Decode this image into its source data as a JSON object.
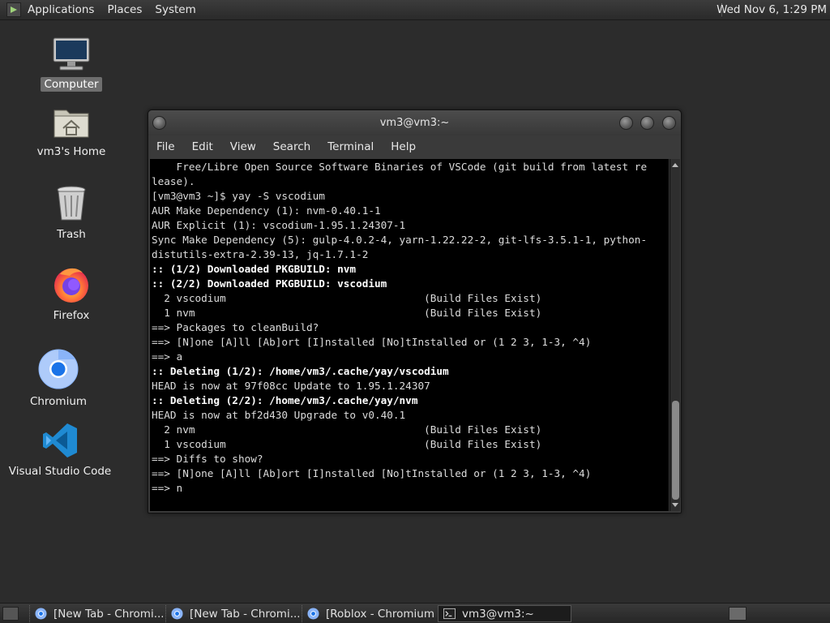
{
  "top_panel": {
    "menus": [
      "Applications",
      "Places",
      "System"
    ],
    "clock": "Wed Nov  6,  1:29 PM"
  },
  "desktop": {
    "icons": [
      {
        "label": "Computer",
        "icon": "computer-icon"
      },
      {
        "label": "vm3's Home",
        "icon": "home-folder-icon"
      },
      {
        "label": "Trash",
        "icon": "trash-icon"
      },
      {
        "label": "Firefox",
        "icon": "firefox-icon"
      },
      {
        "label": "Chromium",
        "icon": "chromium-icon"
      },
      {
        "label": "Visual Studio Code",
        "icon": "vscode-icon"
      }
    ]
  },
  "terminal": {
    "title": "vm3@vm3:~",
    "menus": [
      "File",
      "Edit",
      "View",
      "Search",
      "Terminal",
      "Help"
    ],
    "lines": [
      {
        "t": "    Free/Libre Open Source Software Binaries of VSCode (git build from latest re",
        "b": false
      },
      {
        "t": "lease).",
        "b": false
      },
      {
        "t": "[vm3@vm3 ~]$ yay -S vscodium",
        "b": false
      },
      {
        "t": "AUR Make Dependency (1): nvm-0.40.1-1",
        "b": false
      },
      {
        "t": "AUR Explicit (1): vscodium-1.95.1.24307-1",
        "b": false
      },
      {
        "t": "Sync Make Dependency (5): gulp-4.0.2-4, yarn-1.22.22-2, git-lfs-3.5.1-1, python-",
        "b": false
      },
      {
        "t": "distutils-extra-2.39-13, jq-1.7.1-2",
        "b": false
      },
      {
        "t": ":: (1/2) Downloaded PKGBUILD: nvm",
        "b": true
      },
      {
        "t": ":: (2/2) Downloaded PKGBUILD: vscodium",
        "b": true
      },
      {
        "t": "  2 vscodium                                (Build Files Exist)",
        "b": false
      },
      {
        "t": "  1 nvm                                     (Build Files Exist)",
        "b": false
      },
      {
        "t": "==> Packages to cleanBuild?",
        "b": false
      },
      {
        "t": "==> [N]one [A]ll [Ab]ort [I]nstalled [No]tInstalled or (1 2 3, 1-3, ^4)",
        "b": false
      },
      {
        "t": "==> a",
        "b": false
      },
      {
        "t": ":: Deleting (1/2): /home/vm3/.cache/yay/vscodium",
        "b": true
      },
      {
        "t": "HEAD is now at 97f08cc Update to 1.95.1.24307",
        "b": false
      },
      {
        "t": ":: Deleting (2/2): /home/vm3/.cache/yay/nvm",
        "b": true
      },
      {
        "t": "HEAD is now at bf2d430 Upgrade to v0.40.1",
        "b": false
      },
      {
        "t": "  2 nvm                                     (Build Files Exist)",
        "b": false
      },
      {
        "t": "  1 vscodium                                (Build Files Exist)",
        "b": false
      },
      {
        "t": "==> Diffs to show?",
        "b": false
      },
      {
        "t": "==> [N]one [A]ll [Ab]ort [I]nstalled [No]tInstalled or (1 2 3, 1-3, ^4)",
        "b": false
      },
      {
        "t": "==> n",
        "b": false
      }
    ]
  },
  "taskbar": {
    "tasks": [
      {
        "label": "[New Tab - Chromi...",
        "icon": "chromium-icon",
        "active": false
      },
      {
        "label": "[New Tab - Chromi...",
        "icon": "chromium-icon",
        "active": false
      },
      {
        "label": "[Roblox - Chromium]",
        "icon": "chromium-icon",
        "active": false
      },
      {
        "label": "vm3@vm3:~",
        "icon": "terminal-icon",
        "active": true
      }
    ]
  },
  "colors": {
    "panel_bg": "#2f2f2f",
    "desktop_bg": "#2c2c2c",
    "console_bg": "#000000",
    "console_fg": "#dcdcdc"
  }
}
